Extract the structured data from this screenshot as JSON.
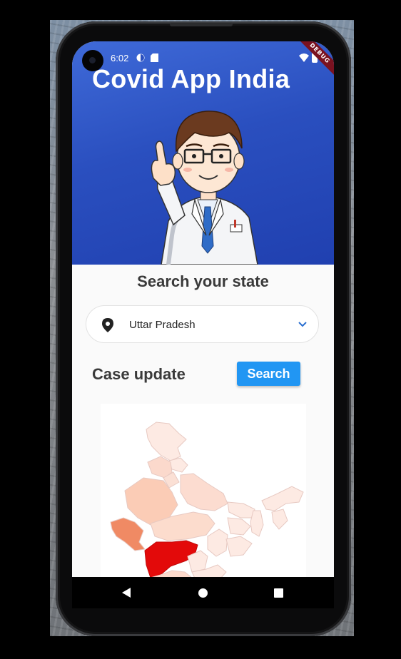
{
  "statusbar": {
    "time": "6:02",
    "debug_label": "DEBUG"
  },
  "header": {
    "title": "Covid App India",
    "background_color": "#2a4fbf",
    "illustration": "doctor-pointing-illustration"
  },
  "search": {
    "heading": "Search your state",
    "selected_state": "Uttar Pradesh",
    "leading_icon": "location-pin-icon",
    "trailing_icon": "chevron-down-icon"
  },
  "cases": {
    "heading": "Case update",
    "search_button_label": "Search",
    "button_color": "#2196f3",
    "map": "india-state-choropleth-map",
    "highlight_colors": {
      "high": "#e30a0a",
      "medium": "#f08a64",
      "low": "#fbd4c4",
      "lowest": "#fdeae3"
    }
  },
  "navbar": {
    "back_icon": "back-triangle-icon",
    "home_icon": "home-circle-icon",
    "recents_icon": "recents-square-icon"
  }
}
